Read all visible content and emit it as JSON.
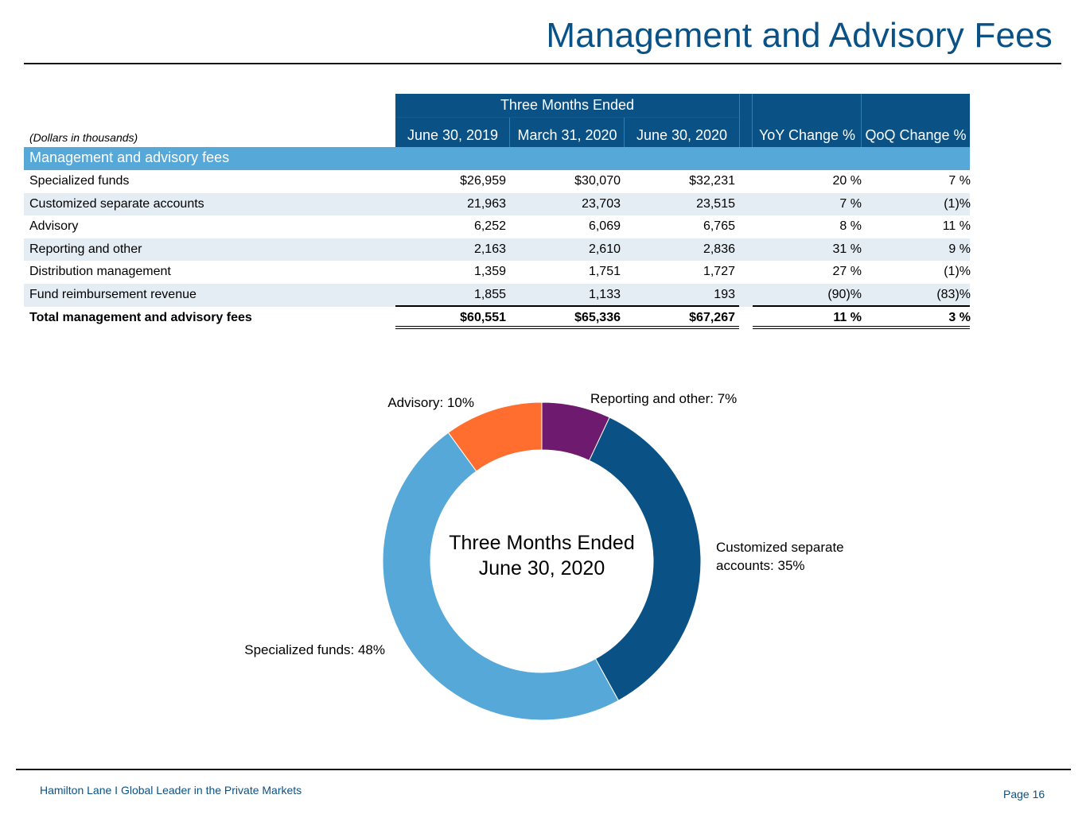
{
  "page": {
    "title": "Management and Advisory Fees",
    "footer_left": "Hamilton Lane I Global Leader in the Private Markets",
    "page_number": "Page 16"
  },
  "table": {
    "units_note": "(Dollars in thousands)",
    "period_header": "Three Months Ended",
    "columns": [
      "June 30, 2019",
      "March 31, 2020",
      "June 30, 2020",
      "YoY Change %",
      "QoQ Change %"
    ],
    "section_label": "Management and advisory fees",
    "rows": [
      {
        "label": "Specialized funds",
        "c1": "$26,959",
        "c2": "$30,070",
        "c3": "$32,231",
        "yoy": "20 %",
        "qoq": "7 %"
      },
      {
        "label": "Customized separate accounts",
        "c1": "21,963",
        "c2": "23,703",
        "c3": "23,515",
        "yoy": "7 %",
        "qoq": "(1)%"
      },
      {
        "label": "Advisory",
        "c1": "6,252",
        "c2": "6,069",
        "c3": "6,765",
        "yoy": "8 %",
        "qoq": "11 %"
      },
      {
        "label": "Reporting and other",
        "c1": "2,163",
        "c2": "2,610",
        "c3": "2,836",
        "yoy": "31 %",
        "qoq": "9 %"
      },
      {
        "label": "Distribution management",
        "c1": "1,359",
        "c2": "1,751",
        "c3": "1,727",
        "yoy": "27 %",
        "qoq": "(1)%"
      },
      {
        "label": "Fund reimbursement revenue",
        "c1": "1,855",
        "c2": "1,133",
        "c3": "193",
        "yoy": "(90)%",
        "qoq": "(83)%"
      }
    ],
    "total": {
      "label": "Total management and advisory fees",
      "c1": "$60,551",
      "c2": "$65,336",
      "c3": "$67,267",
      "yoy": "11 %",
      "qoq": "3 %"
    }
  },
  "chart_data": {
    "type": "pie",
    "center_line1": "Three Months Ended",
    "center_line2": "June 30, 2020",
    "slices": [
      {
        "label": "Reporting and other: 7%",
        "value": 7,
        "color": "#6e1a6e"
      },
      {
        "label": "Customized separate accounts: 35%",
        "value": 35,
        "color": "#0a5286"
      },
      {
        "label": "Specialized funds: 48%",
        "value": 48,
        "color": "#55a8d7"
      },
      {
        "label": "Advisory: 10%",
        "value": 10,
        "color": "#ff6e2e"
      }
    ]
  }
}
